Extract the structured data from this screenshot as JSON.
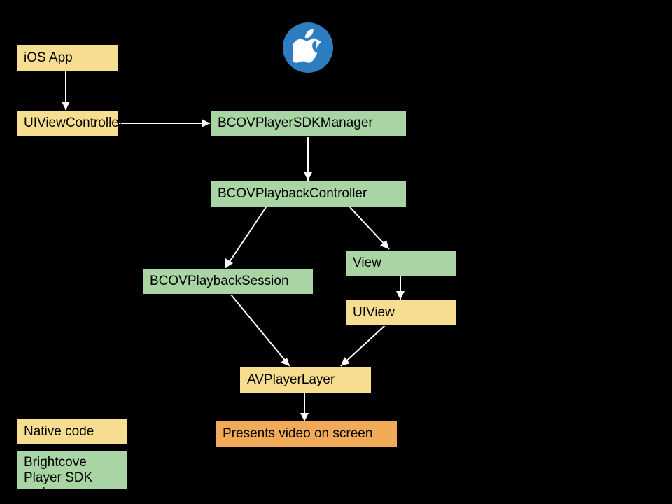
{
  "nodes": {
    "ios_app": "iOS App",
    "uiviewcontroller": "UIViewController",
    "bcovplayersdkmanager": "BCOVPlayerSDKManager",
    "bcovplaybackcontroller": "BCOVPlaybackController",
    "bcovplaybacksession": "BCOVPlaybackSession",
    "view": "View",
    "uiview": "UIView",
    "avplayerlayer": "AVPlayerLayer",
    "presents_video": "Presents video on screen"
  },
  "legend": {
    "native": "Native code",
    "brightcove": "Brightcove Player SDK code"
  }
}
